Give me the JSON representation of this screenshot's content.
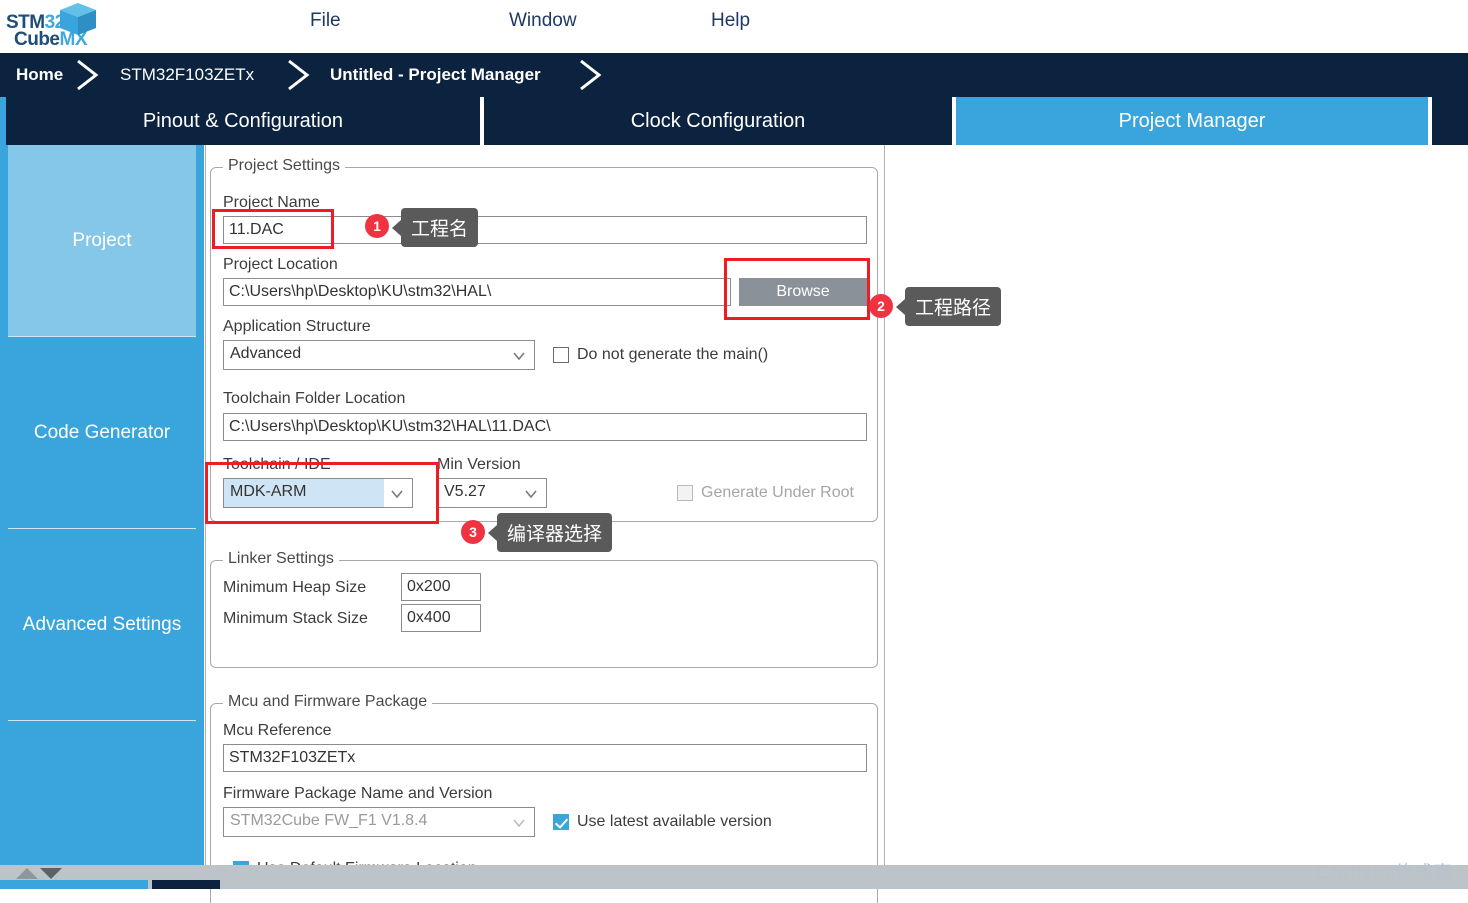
{
  "app": {
    "logo": {
      "line1_dark": "STM",
      "line1_light": "32",
      "line2_dark": "Cube",
      "line2_light": "MX"
    }
  },
  "menu": {
    "items": [
      "File",
      "Window",
      "Help"
    ]
  },
  "breadcrumb": {
    "items": [
      "Home",
      "STM32F103ZETx",
      "Untitled - Project Manager"
    ]
  },
  "tabs": [
    {
      "label": "Pinout & Configuration",
      "selected": false
    },
    {
      "label": "Clock Configuration",
      "selected": false
    },
    {
      "label": "Project Manager",
      "selected": true
    },
    {
      "label": "",
      "selected": false
    }
  ],
  "sidebar": {
    "items": [
      {
        "label": "Project",
        "active": true
      },
      {
        "label": "Code Generator",
        "active": false
      },
      {
        "label": "Advanced Settings",
        "active": false
      },
      {
        "label": "",
        "active": false
      }
    ]
  },
  "project_settings": {
    "group_title": "Project Settings",
    "project_name_label": "Project Name",
    "project_name_value": "11.DAC",
    "project_location_label": "Project Location",
    "project_location_value": "C:\\Users\\hp\\Desktop\\KU\\stm32\\HAL\\",
    "browse_button": "Browse",
    "application_structure_label": "Application Structure",
    "application_structure_value": "Advanced",
    "do_not_generate_main_label": "Do not generate the main()",
    "do_not_generate_main_checked": false,
    "toolchain_folder_label": "Toolchain Folder Location",
    "toolchain_folder_value": "C:\\Users\\hp\\Desktop\\KU\\stm32\\HAL\\11.DAC\\",
    "toolchain_ide_label": "Toolchain / IDE",
    "toolchain_ide_value": "MDK-ARM",
    "min_version_label": "Min Version",
    "min_version_value": "V5.27",
    "generate_under_root_label": "Generate Under Root",
    "generate_under_root_checked": false,
    "generate_under_root_disabled": true
  },
  "linker_settings": {
    "group_title": "Linker Settings",
    "min_heap_label": "Minimum Heap Size",
    "min_heap_value": "0x200",
    "min_stack_label": "Minimum Stack Size",
    "min_stack_value": "0x400"
  },
  "mcu_firmware": {
    "group_title": "Mcu and Firmware Package",
    "mcu_reference_label": "Mcu Reference",
    "mcu_reference_value": "STM32F103ZETx",
    "firmware_package_label": "Firmware Package Name and Version",
    "firmware_package_value": "STM32Cube FW_F1 V1.8.4",
    "use_latest_label": "Use latest available version",
    "use_latest_checked": true,
    "use_default_location_label": "Use Default Firmware Location",
    "use_default_location_checked": true
  },
  "annotations": [
    {
      "number": "1",
      "text": "工程名"
    },
    {
      "number": "2",
      "text": "工程路径"
    },
    {
      "number": "3",
      "text": "编译器选择"
    }
  ],
  "watermark": "CSDN @修成真",
  "colors": {
    "accent": "#3aa5dc",
    "navy": "#0c2340",
    "sidebar_active": "#85c7e8",
    "annotation_red": "#ee1c25",
    "badge_red": "#ef3340",
    "tooltip_grey": "#5a5a5a",
    "button_grey": "#8b9199"
  }
}
